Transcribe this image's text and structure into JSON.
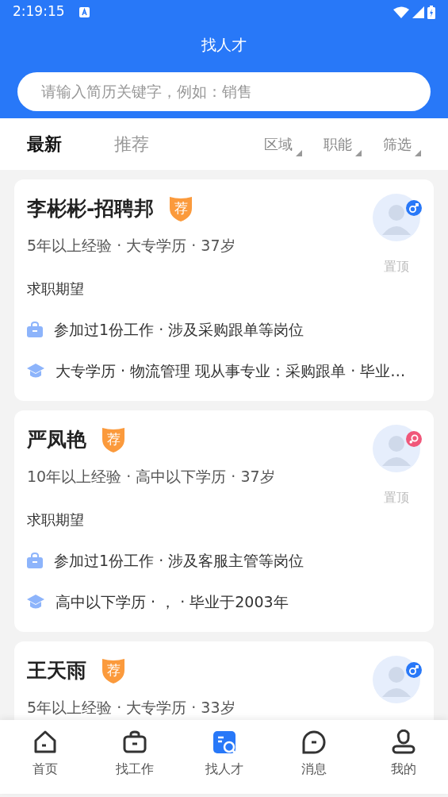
{
  "status_bar": {
    "time": "2:19:15"
  },
  "header": {
    "title": "找人才"
  },
  "search": {
    "placeholder": "请输入简历关键字，例如：销售"
  },
  "tabs": [
    {
      "label": "最新",
      "selected": true
    },
    {
      "label": "推荐",
      "selected": false
    }
  ],
  "filters": [
    "区域",
    "职能",
    "筛选"
  ],
  "candidates": [
    {
      "name": "李彬彬-招聘邦",
      "badge": "荐",
      "male": true,
      "meta": "5年以上经验 · 大专学历 · 37岁",
      "pin": "置顶",
      "section": "求职期望",
      "work": "参加过1份工作 · 涉及采购跟单等岗位",
      "education": "大专学历 · 物流管理 现从事专业：采购跟单 · 毕业…"
    },
    {
      "name": "严凤艳",
      "badge": "荐",
      "male": false,
      "meta": "10年以上经验 · 高中以下学历 · 37岁",
      "pin": "置顶",
      "section": "求职期望",
      "work": "参加过1份工作 · 涉及客服主管等岗位",
      "education": "高中以下学历 · ，  · 毕业于2003年"
    },
    {
      "name": "王天雨",
      "badge": "荐",
      "male": true,
      "meta": "5年以上经验 · 大专学历 · 33岁"
    }
  ],
  "bottom_nav": [
    {
      "label": "首页",
      "kind": "home",
      "selected": false
    },
    {
      "label": "找工作",
      "kind": "job",
      "selected": false
    },
    {
      "label": "找人才",
      "kind": "talent",
      "selected": true
    },
    {
      "label": "消息",
      "kind": "message",
      "selected": false
    },
    {
      "label": "我的",
      "kind": "profile",
      "selected": false
    }
  ]
}
